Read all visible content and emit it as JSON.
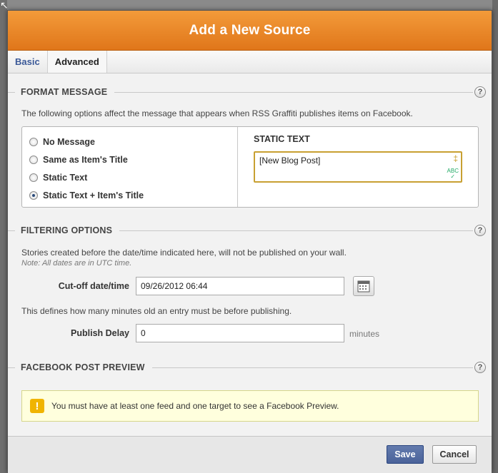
{
  "dialog": {
    "title": "Add a New Source"
  },
  "tabs": [
    {
      "label": "Basic"
    },
    {
      "label": "Advanced"
    }
  ],
  "format_message": {
    "heading": "FORMAT MESSAGE",
    "help": "?",
    "description": "The following options affect the message that appears when RSS Graffiti publishes items on Facebook.",
    "options": [
      {
        "label": "No Message",
        "checked": false
      },
      {
        "label": "Same as Item's Title",
        "checked": false
      },
      {
        "label": "Static Text",
        "checked": false
      },
      {
        "label": "Static Text + Item's Title",
        "checked": true
      }
    ],
    "static_text_heading": "STATIC TEXT",
    "static_text_value": "[New Blog Post]",
    "spell_icon_text": "ABC"
  },
  "filtering": {
    "heading": "FILTERING OPTIONS",
    "help": "?",
    "description": "Stories created before the date/time indicated here, will not be published on your wall.",
    "note": "Note: All dates are in UTC time.",
    "cutoff_label": "Cut-off date/time",
    "cutoff_value": "09/26/2012 06:44",
    "delay_description": "This defines how many minutes old an entry must be before publishing.",
    "delay_label": "Publish Delay",
    "delay_value": "0",
    "delay_unit": "minutes"
  },
  "preview": {
    "heading": "FACEBOOK POST PREVIEW",
    "help": "?",
    "warning_icon": "!",
    "warning_text": "You must have at least one feed and one target to see a Facebook Preview."
  },
  "footer": {
    "save_label": "Save",
    "cancel_label": "Cancel"
  },
  "colors": {
    "title_bar": "#e88420",
    "save_button": "#5b74a8",
    "warning_bg": "#ffffdd",
    "input_focus": "#c8a032"
  }
}
